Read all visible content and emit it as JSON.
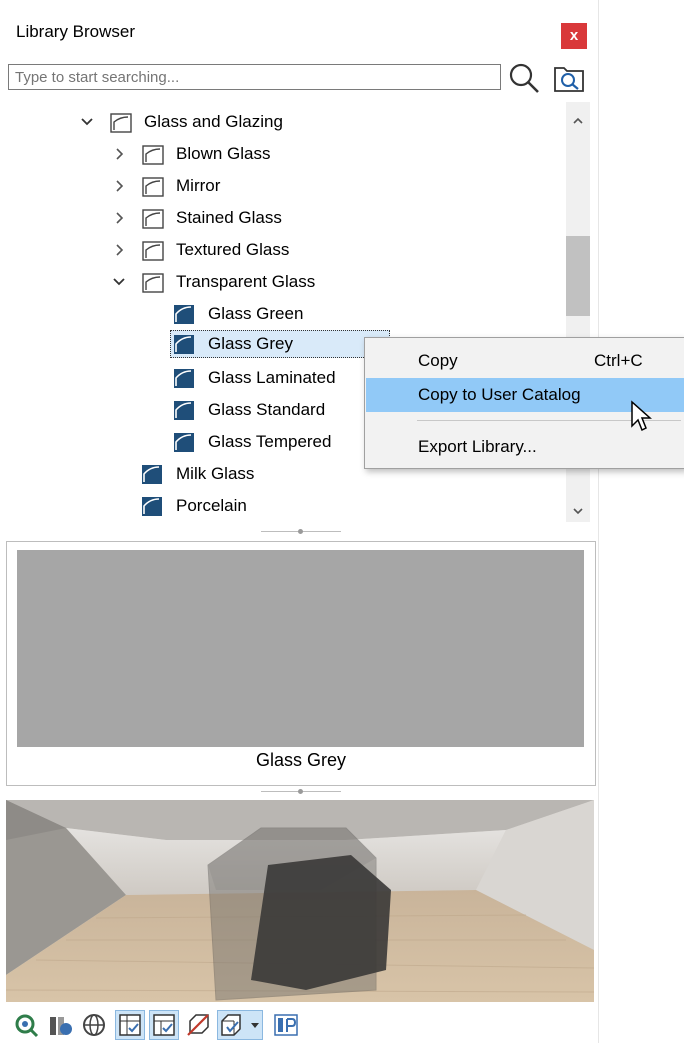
{
  "panel": {
    "title": "Library Browser",
    "close_glyph": "x",
    "search": {
      "placeholder": "Type to start searching..."
    }
  },
  "tree": {
    "items": [
      {
        "label": "Glass and Glazing",
        "type": "folder",
        "expanded": true
      },
      {
        "label": "Blown Glass",
        "type": "folder",
        "expanded": false
      },
      {
        "label": "Mirror",
        "type": "folder",
        "expanded": false
      },
      {
        "label": "Stained Glass",
        "type": "folder",
        "expanded": false
      },
      {
        "label": "Textured Glass",
        "type": "folder",
        "expanded": false
      },
      {
        "label": "Transparent Glass",
        "type": "folder",
        "expanded": true
      },
      {
        "label": "Glass  Green",
        "type": "material"
      },
      {
        "label": "Glass  Grey",
        "type": "material",
        "selected": true
      },
      {
        "label": "Glass  Laminated",
        "type": "material"
      },
      {
        "label": "Glass  Standard",
        "type": "material"
      },
      {
        "label": "Glass  Tempered",
        "type": "material"
      },
      {
        "label": "Milk Glass",
        "type": "material"
      },
      {
        "label": "Porcelain",
        "type": "material"
      }
    ]
  },
  "preview": {
    "name": "Glass  Grey",
    "swatch_color": "#a6a6a6"
  },
  "context_menu": {
    "items": [
      {
        "label": "Copy",
        "shortcut": "Ctrl+C"
      },
      {
        "label": "Copy to User Catalog",
        "shortcut": "",
        "highlighted": true
      },
      {
        "label": "Export Library...",
        "shortcut": ""
      }
    ]
  },
  "colors": {
    "close_button": "#d9383a",
    "selection": "#d9eaf9",
    "menu_highlight": "#91c9f7",
    "material_icon": "#1f4e79"
  },
  "toolbar": {
    "buttons": [
      "refresh-render-icon",
      "material-paint-icon",
      "globe-view-icon",
      "show-checked-icon",
      "filter-checked-icon",
      "no-material-icon",
      "cube-dropdown-icon",
      "bp-icon"
    ]
  }
}
